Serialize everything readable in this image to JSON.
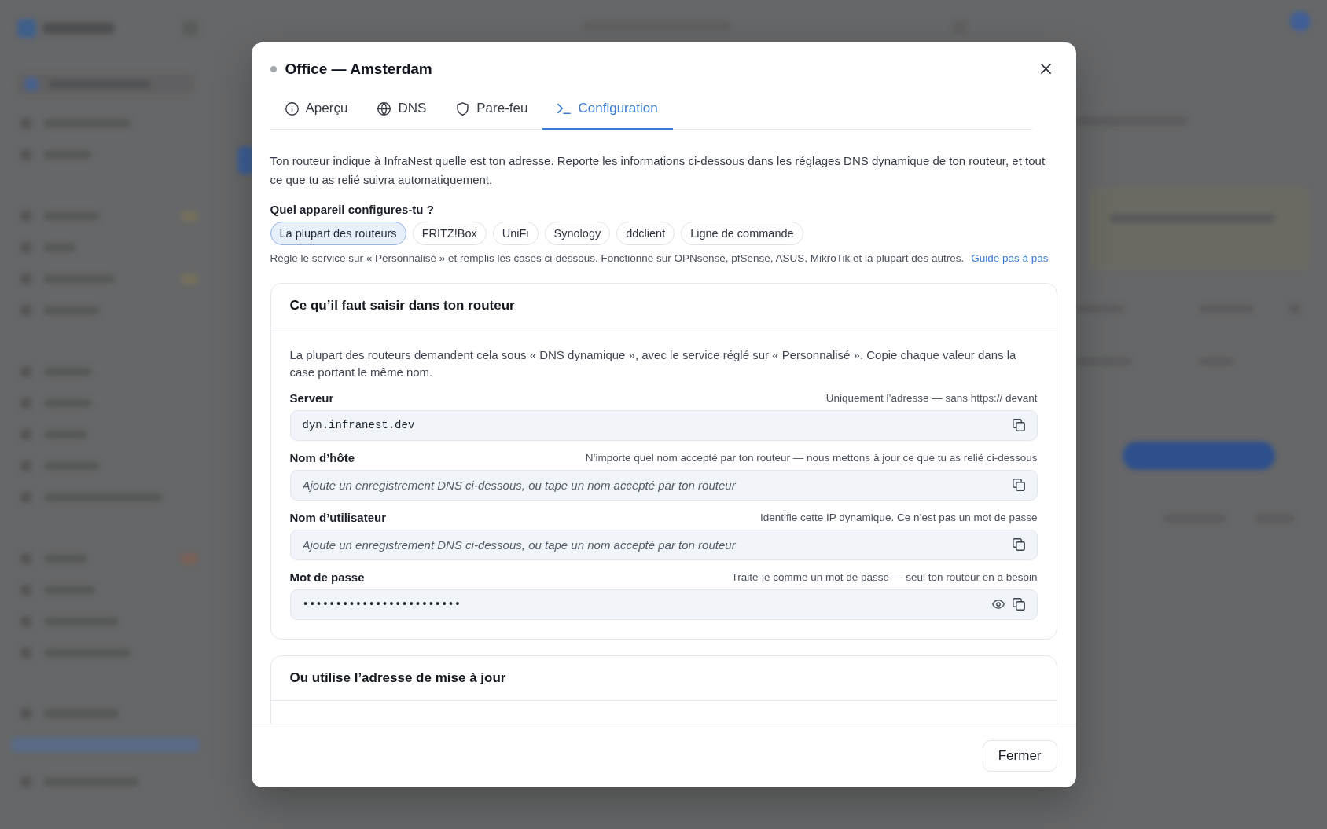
{
  "dialog": {
    "title": "Office — Amsterdam"
  },
  "tabs": [
    {
      "label": "Aperçu",
      "selected": false
    },
    {
      "label": "DNS",
      "selected": false
    },
    {
      "label": "Pare-feu",
      "selected": false
    },
    {
      "label": "Configuration",
      "selected": true
    }
  ],
  "intro": "Ton routeur indique à InfraNest quelle est ton adresse. Reporte les informations ci-dessous dans les réglages DNS dynamique de ton routeur, et tout ce que tu as relié suivra automatiquement.",
  "device_picker": {
    "label": "Quel appareil configures-tu ?",
    "options": [
      {
        "label": "La plupart des routeurs",
        "selected": true
      },
      {
        "label": "FRITZ!Box",
        "selected": false
      },
      {
        "label": "UniFi",
        "selected": false
      },
      {
        "label": "Synology",
        "selected": false
      },
      {
        "label": "ddclient",
        "selected": false
      },
      {
        "label": "Ligne de commande",
        "selected": false
      }
    ],
    "hint": "Règle le service sur « Personnalisé » et remplis les cases ci-dessous. Fonctionne sur OPNsense, pfSense, ASUS, MikroTik et la plupart des autres.",
    "link": "Guide pas à pas"
  },
  "sections": [
    {
      "title": "Ce qu’il faut saisir dans ton routeur",
      "description": "La plupart des routeurs demandent cela sous « DNS dynamique », avec le service réglé sur « Personnalisé ». Copie chaque valeur dans la case portant le même nom.",
      "fields": [
        {
          "kind": "text",
          "label": "Serveur",
          "hint": "Uniquement l’adresse — sans https:// devant",
          "value": "dyn.infranest.dev"
        },
        {
          "kind": "text",
          "label": "Nom d’hôte",
          "hint": "N’importe quel nom accepté par ton routeur — nous mettons à jour ce que tu as relié ci-dessous",
          "placeholder": "Ajoute un enregistrement DNS ci-dessous, ou tape un nom accepté par ton routeur"
        },
        {
          "kind": "text",
          "label": "Nom d’utilisateur",
          "hint": "Identifie cette IP dynamique. Ce n’est pas un mot de passe",
          "placeholder": "Ajoute un enregistrement DNS ci-dessous, ou tape un nom accepté par ton routeur"
        },
        {
          "kind": "secret",
          "label": "Mot de passe",
          "hint": "Traite-le comme un mot de passe — seul ton routeur en a besoin",
          "value": "••••••••••••••••••••••••"
        }
      ]
    },
    {
      "title": "Ou utilise l’adresse de mise à jour"
    }
  ],
  "footer": {
    "button": "Fermer"
  }
}
